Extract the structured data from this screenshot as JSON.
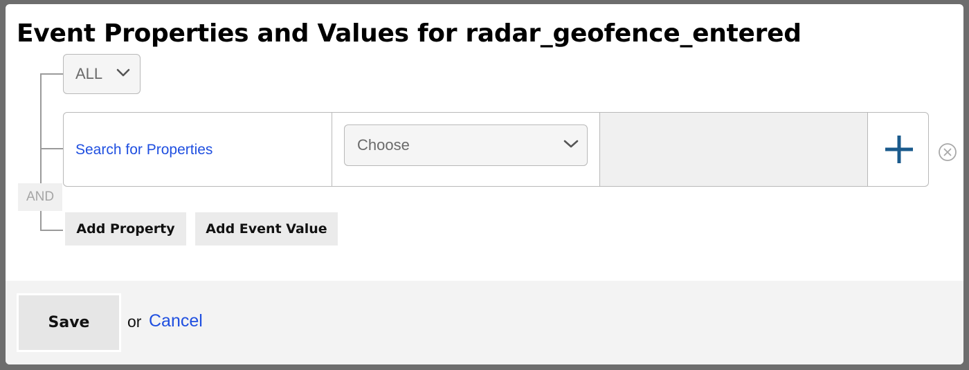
{
  "modal": {
    "title": "Event Properties and Values for radar_geofence_entered"
  },
  "filter": {
    "match_mode": "ALL",
    "group_operator": "AND",
    "row": {
      "property_placeholder": "Search for Properties",
      "operator_value": "Choose",
      "value": ""
    },
    "actions": {
      "add_property_label": "Add Property",
      "add_event_value_label": "Add Event Value"
    }
  },
  "footer": {
    "save_label": "Save",
    "or_text": "or",
    "cancel_label": "Cancel"
  },
  "colors": {
    "link": "#1f4fe0",
    "plus_icon": "#1a5a8c",
    "value_cell_bg": "#f0f0f0",
    "footer_bg": "#f3f3f3"
  },
  "icons": {
    "dropdown": "chevron-down-icon",
    "add_row": "plus-icon",
    "remove_row": "close-circle-icon"
  }
}
